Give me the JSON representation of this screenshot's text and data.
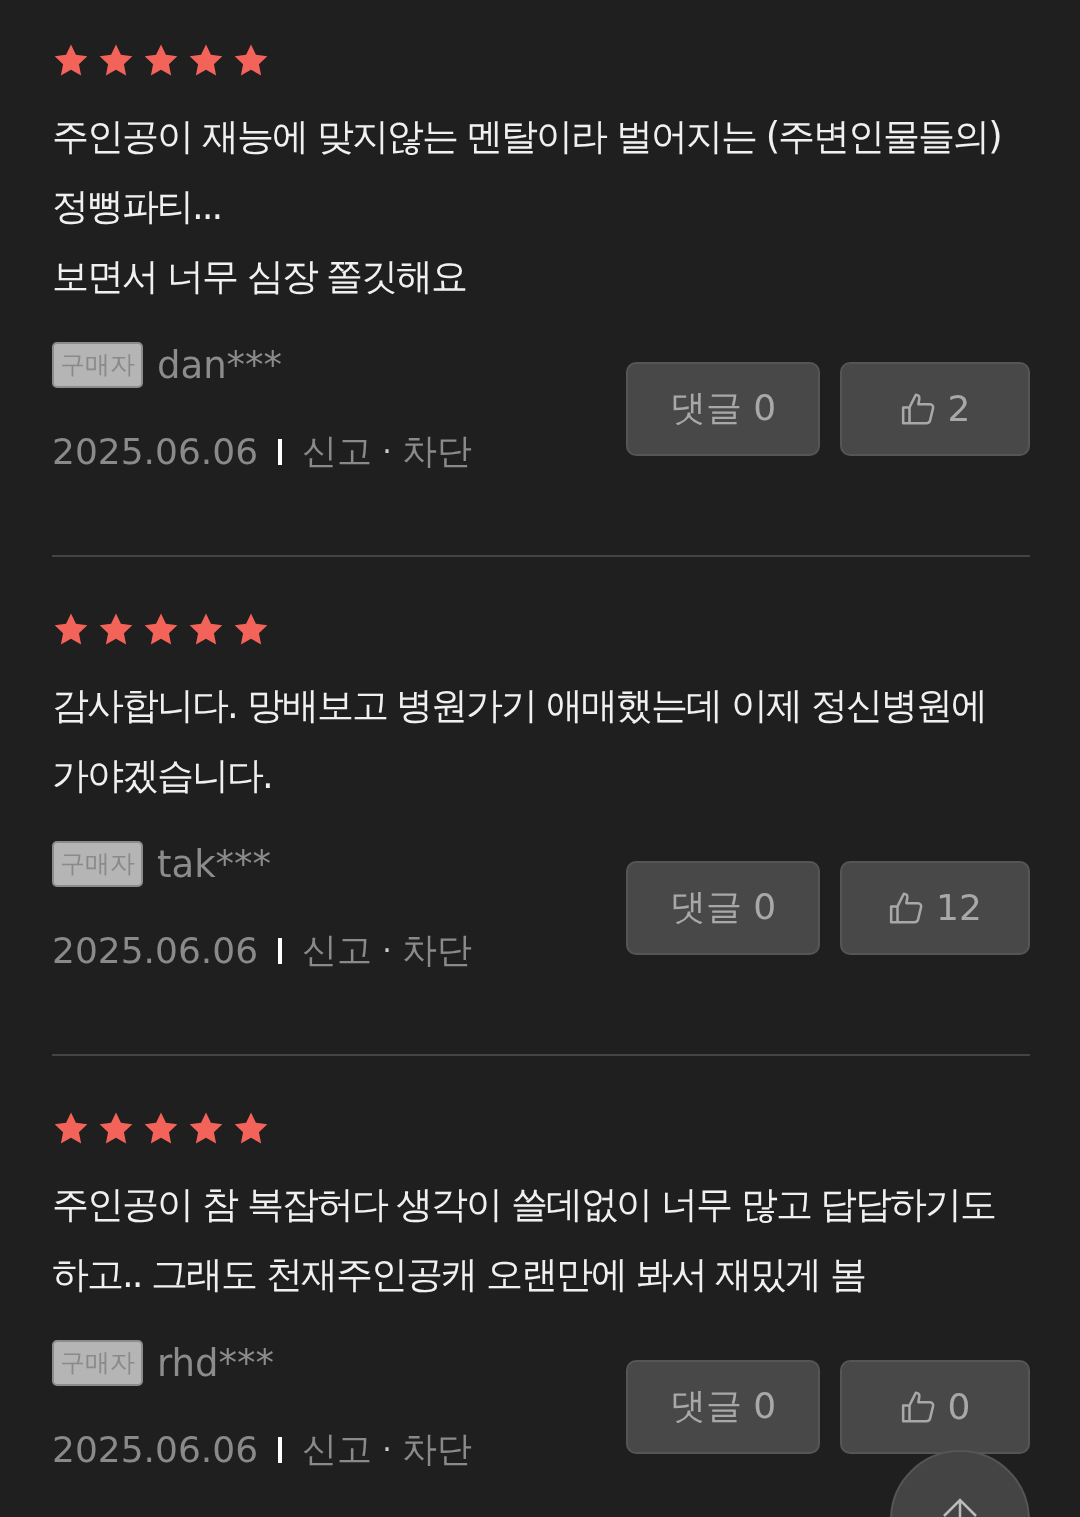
{
  "reviews": [
    {
      "stars": 5,
      "lines": [
        "주인공이 재능에 맞지않는 멘탈이라 벌어지는 (주변인물들의) 정뻥파티...",
        "보면서 너무 심장 쫄깃해요"
      ],
      "badge": "구매자",
      "user": "dan***",
      "date": "2025.06.06",
      "report": "신고",
      "dot": "·",
      "block": "차단",
      "comment_button": "댓글 0",
      "likes": "2"
    },
    {
      "stars": 5,
      "lines": [
        "감사합니다. 망배보고 병원가기 애매했는데 이제 정신병원에 가야겠습니다."
      ],
      "badge": "구매자",
      "user": "tak***",
      "date": "2025.06.06",
      "report": "신고",
      "dot": "·",
      "block": "차단",
      "comment_button": "댓글 0",
      "likes": "12"
    },
    {
      "stars": 5,
      "lines": [
        "주인공이 참 복잡허다 생각이 쓸데없이 너무 많고 답답하기도 하고.. 그래도 천재주인공캐 오랜만에 봐서 재밌게 봄"
      ],
      "badge": "구매자",
      "user": "rhd***",
      "date": "2025.06.06",
      "report": "신고",
      "dot": "·",
      "block": "차단",
      "comment_button": "댓글 0",
      "likes": "0"
    }
  ]
}
